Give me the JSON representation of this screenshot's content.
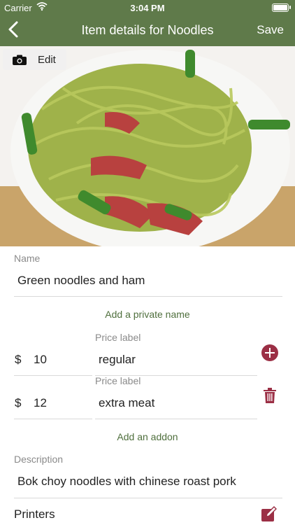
{
  "status_bar": {
    "carrier": "Carrier",
    "time": "3:04 PM"
  },
  "nav": {
    "title": "Item details for Noodles",
    "save_label": "Save"
  },
  "photo": {
    "edit_label": "Edit"
  },
  "form": {
    "name_label": "Name",
    "name_value": "Green noodles and ham",
    "add_private_name": "Add a private name",
    "prices": [
      {
        "currency": "$",
        "amount": "10",
        "label_caption": "Price label",
        "label_value": "regular"
      },
      {
        "currency": "$",
        "amount": "12",
        "label_caption": "Price label",
        "label_value": "extra meat"
      }
    ],
    "add_addon": "Add an addon",
    "description_label": "Description",
    "description_value": "Bok choy noodles with chinese roast pork",
    "printers_label": "Printers"
  },
  "colors": {
    "nav_bg": "#5f7a4a",
    "accent_red": "#9b2f45",
    "link_green": "#4f6f3d"
  },
  "icons": [
    "back-chevron-icon",
    "wifi-icon",
    "battery-icon",
    "camera-icon",
    "plus-circle-icon",
    "trash-icon",
    "edit-pencil-icon"
  ]
}
